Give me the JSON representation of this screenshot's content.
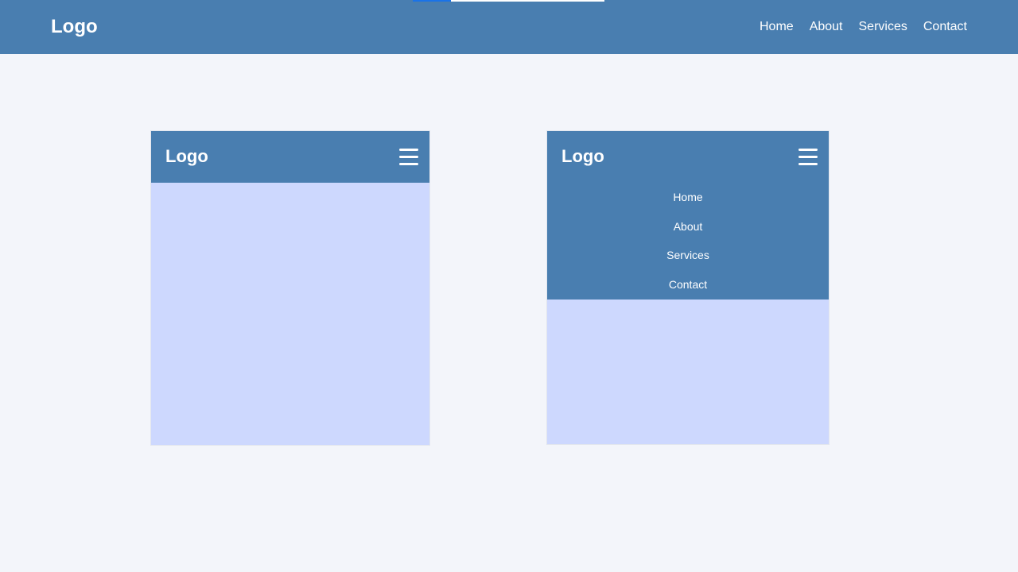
{
  "header": {
    "logo": "Logo",
    "nav": [
      "Home",
      "About",
      "Services",
      "Contact"
    ]
  },
  "mobile_closed": {
    "logo": "Logo",
    "menu_icon": "hamburger-icon"
  },
  "mobile_open": {
    "logo": "Logo",
    "menu_icon": "hamburger-icon",
    "menu": [
      "Home",
      "About",
      "Services",
      "Contact"
    ]
  },
  "colors": {
    "nav_bg": "#497eb0",
    "page_bg": "#f3f5fa",
    "mobile_content_bg": "#cdd8fe",
    "text": "#ffffff"
  }
}
